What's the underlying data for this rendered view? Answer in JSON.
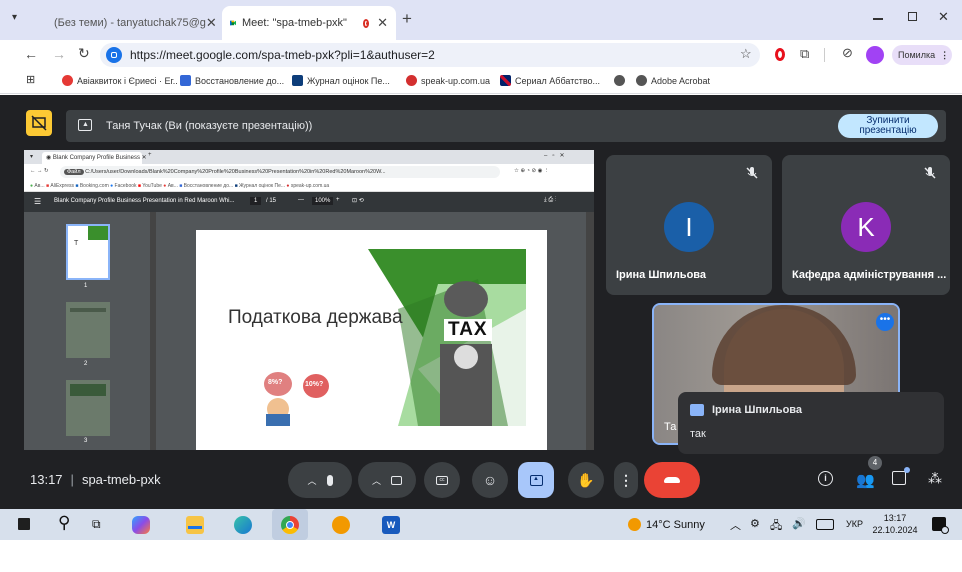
{
  "browser": {
    "tabs": [
      {
        "label": "(Без теми) - tanyatuchak75@g",
        "active": false
      },
      {
        "label": "Meet: \"spa-tmeb-pxk\"",
        "active": true
      }
    ],
    "new_tab": "+",
    "url": "https://meet.google.com/spa-tmeb-pxk?pli=1&authuser=2",
    "profile_button": "Помилка",
    "bookmarks": [
      "Авіаквиток і Єриесі · Ег..",
      "Восстановление до...",
      "Журнал оцінок Пе...",
      "speak-up.com.ua",
      "Сериал Аббатство...",
      "",
      "Adobe Acrobat"
    ]
  },
  "meet": {
    "presenting_text": "Таня Тучак (Ви (показуєте презентацію))",
    "stop_button": "Зупинити презентацію",
    "meeting_time": "13:17",
    "meeting_code": "spa-tmeb-pxk",
    "participants_count": "4",
    "participants": [
      {
        "initial": "І",
        "name": "Ірина Шпильова",
        "color": "#1a5fa8"
      },
      {
        "initial": "K",
        "name": "Кафедра адміністрування ...",
        "color": "#8a2bb6"
      }
    ],
    "self_tile_name": "Та",
    "chat_popup": {
      "sender": "Ірина Шпильова",
      "message": "так"
    }
  },
  "shared_screen": {
    "tab_title": "Blank Company Profile Business",
    "url_text": "C:/Users/user/Downloads/Blank%20Company%20Profile%20Business%20Presentation%20in%20Red%20Maroon%20W...",
    "file_label": "Файл",
    "doc_title": "Blank Company Profile Business Presentation in Red Maroon Whi...",
    "page_current": "1",
    "page_total": "/ 15",
    "zoom": "100%",
    "thumb_numbers": [
      "1",
      "2",
      "3"
    ],
    "slide_title": "Податкова держава",
    "slide_bag_text": "TAX",
    "slide_bubble_left": "8%?",
    "slide_bubble_right": "10%?"
  },
  "taskbar": {
    "weather": "14°C Sunny",
    "lang": "УКР",
    "time": "13:17",
    "date": "22.10.2024"
  }
}
